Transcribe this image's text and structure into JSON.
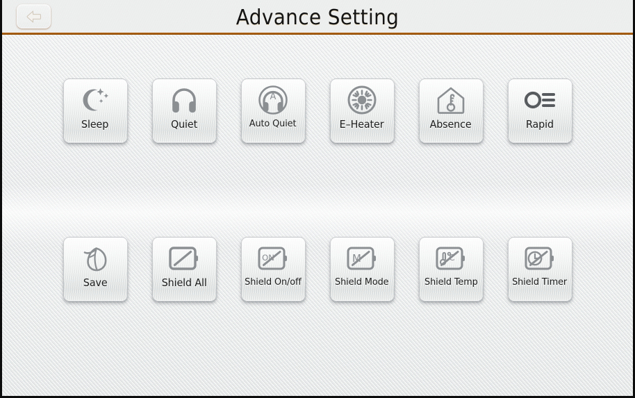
{
  "header": {
    "title": "Advance Setting",
    "back_label": "Back",
    "back_icon": "left-arrow-icon",
    "accent_color": "#e99a2e",
    "title_color": "#141414"
  },
  "theme": {
    "background_color": "#eceded",
    "tile_color": "#f0f2f2",
    "icon_color": "#8a8e91",
    "label_color": "#1b1b1b"
  },
  "rows": [
    {
      "name": "row-1",
      "tiles": [
        {
          "label": "Sleep",
          "icon": "moon-stars-icon",
          "small": false
        },
        {
          "label": "Quiet",
          "icon": "headphones-icon",
          "small": false
        },
        {
          "label": "Auto Quiet",
          "icon": "headphones-auto-icon",
          "small": true
        },
        {
          "label": "E–Heater",
          "icon": "sun-rays-icon",
          "small": false
        },
        {
          "label": "Absence",
          "icon": "house-thermometer-icon",
          "small": false
        },
        {
          "label": "Rapid",
          "icon": "circle-lines-icon",
          "small": false
        }
      ]
    },
    {
      "name": "row-2",
      "tiles": [
        {
          "label": "Save",
          "icon": "leaf-icon",
          "small": false
        },
        {
          "label": "Shield All",
          "icon": "remote-slash-icon",
          "small": false
        },
        {
          "label": "Shield On/off",
          "icon": "remote-on-slash-icon",
          "small": true
        },
        {
          "label": "Shield Mode",
          "icon": "remote-mode-slash-icon",
          "small": true
        },
        {
          "label": "Shield Temp",
          "icon": "remote-temp-slash-icon",
          "small": true
        },
        {
          "label": "Shield Timer",
          "icon": "remote-timer-slash-icon",
          "small": true
        }
      ]
    }
  ]
}
